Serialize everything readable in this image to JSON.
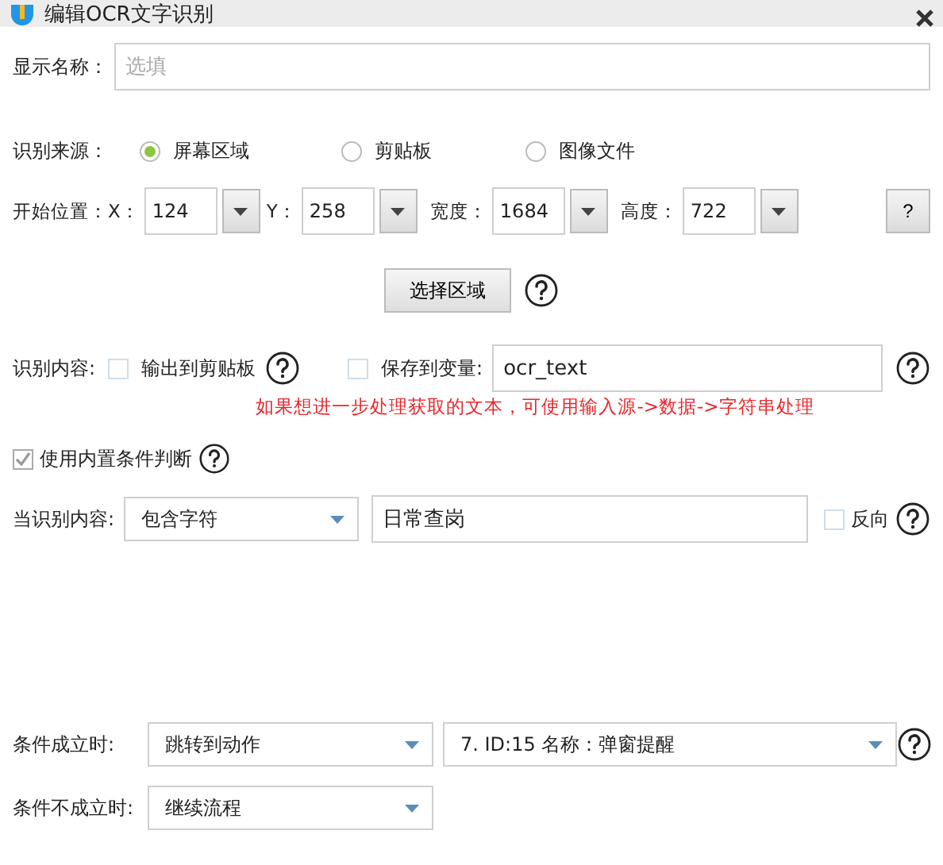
{
  "window": {
    "title": "编辑OCR文字识别"
  },
  "display_name": {
    "label": "显示名称：",
    "placeholder": "选填"
  },
  "source": {
    "label": "识别来源：",
    "options": [
      {
        "label": "屏幕区域",
        "selected": true
      },
      {
        "label": "剪贴板",
        "selected": false
      },
      {
        "label": "图像文件",
        "selected": false
      }
    ]
  },
  "position": {
    "label": "开始位置：",
    "fields": [
      {
        "label": "X：",
        "value": "124"
      },
      {
        "label": "Y：",
        "value": "258"
      },
      {
        "label": "宽度：",
        "value": "1684"
      },
      {
        "label": "高度：",
        "value": "722"
      }
    ],
    "help_button": "?"
  },
  "select_area_button": "选择区域",
  "output": {
    "label": "识别内容:",
    "clipboard": {
      "label": "输出到剪贴板",
      "checked": false
    },
    "variable": {
      "label": "保存到变量:",
      "checked": false,
      "value": "ocr_text"
    },
    "hint": "如果想进一步处理获取的文本，可使用输入源->数据->字符串处理"
  },
  "builtin": {
    "label": "使用内置条件判断",
    "checked": true
  },
  "condition": {
    "label": "当识别内容:",
    "operator": "包含字符",
    "value": "日常查岗",
    "reverse": {
      "label": "反向",
      "checked": false
    }
  },
  "on_true": {
    "label": "条件成立时:",
    "action": "跳转到动作",
    "target": "7. ID:15 名称：弹窗提醒"
  },
  "on_false": {
    "label": "条件不成立时:",
    "action": "继续流程"
  }
}
